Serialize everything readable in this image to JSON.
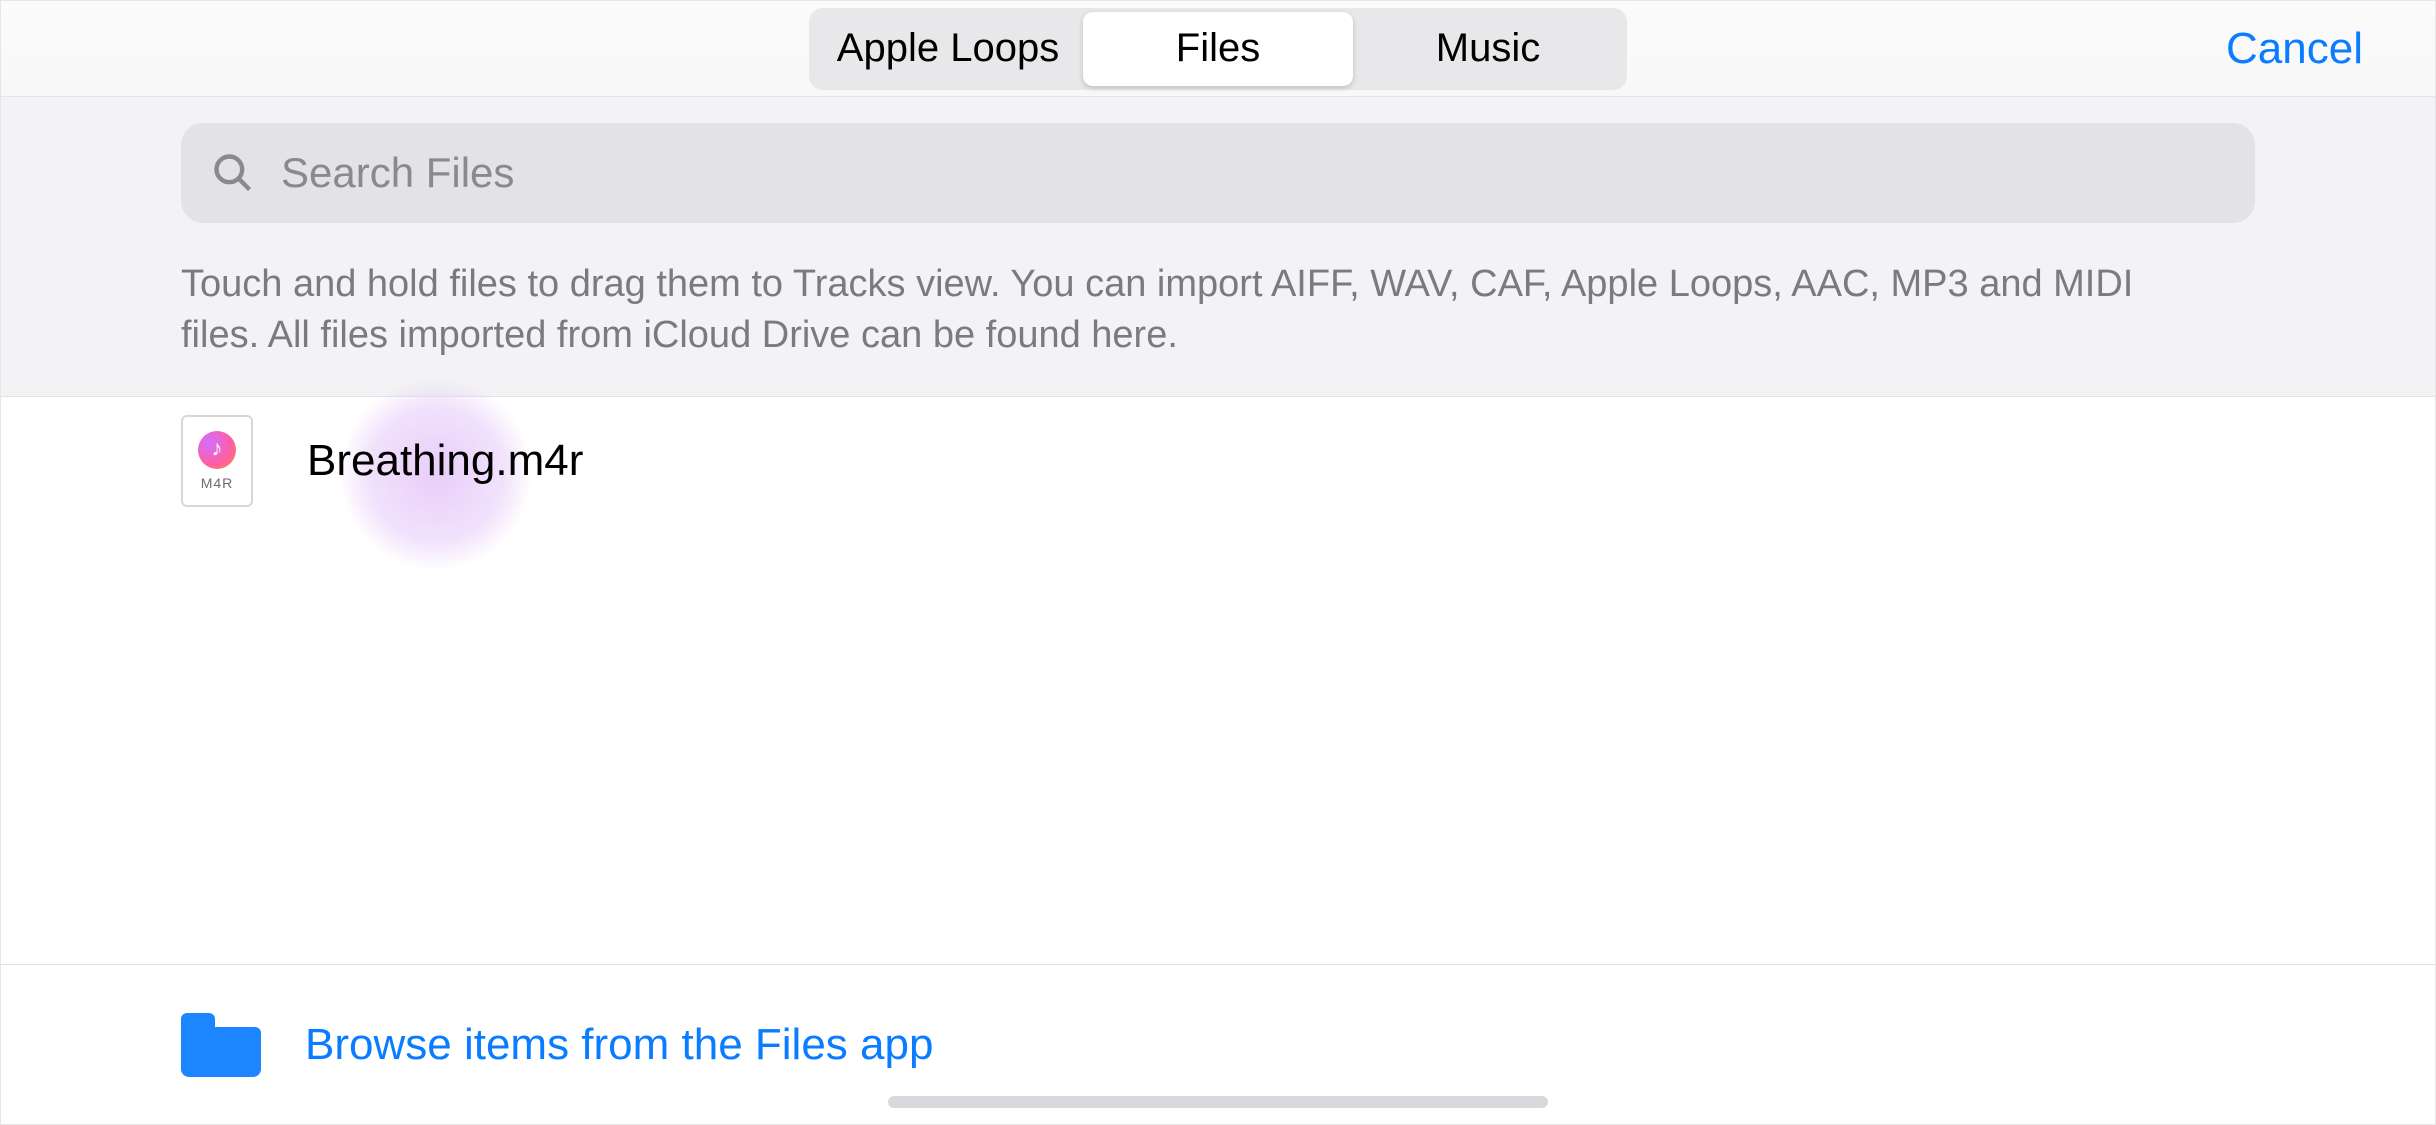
{
  "header": {
    "tabs": [
      {
        "label": "Apple Loops",
        "active": false
      },
      {
        "label": "Files",
        "active": true
      },
      {
        "label": "Music",
        "active": false
      }
    ],
    "cancel_label": "Cancel"
  },
  "search": {
    "placeholder": "Search Files"
  },
  "help_text": "Touch and hold files to drag them to Tracks view. You can import AIFF, WAV, CAF, Apple Loops, AAC, MP3 and MIDI files. All files imported from iCloud Drive can be found here.",
  "files": [
    {
      "name": "Breathing.m4r",
      "ext_label": "M4R"
    }
  ],
  "footer": {
    "browse_label": "Browse items from the Files app"
  },
  "colors": {
    "accent": "#0a7cff",
    "highlight": "#dab6f6"
  }
}
